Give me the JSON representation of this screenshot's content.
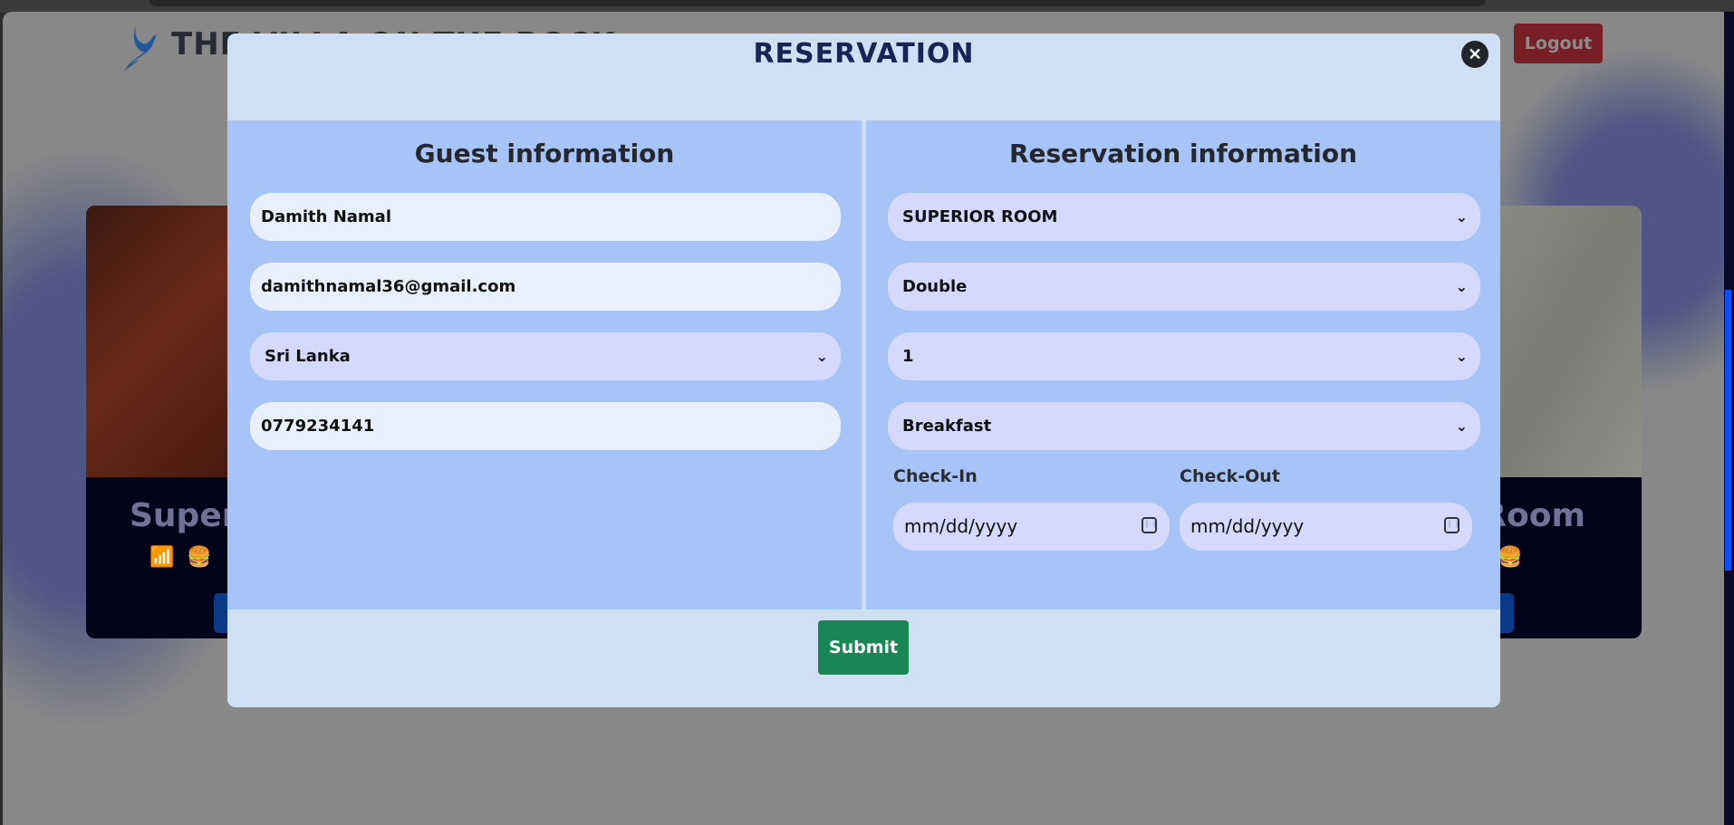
{
  "background": {
    "brand": "THE VILLA ON THE ROCK",
    "logout_label": "Logout",
    "cards": [
      {
        "title": "Superior Room",
        "amenities": [
          "wifi-icon",
          "burger-icon"
        ]
      },
      {
        "title": "Room",
        "amenities": [
          "burger-icon"
        ]
      }
    ]
  },
  "modal": {
    "title": "RESERVATION",
    "close_icon": "close-icon",
    "guest": {
      "heading": "Guest information",
      "name": "Damith Namal",
      "email": "damithnamal36@gmail.com",
      "country": "Sri Lanka",
      "phone": "0779234141"
    },
    "reservation": {
      "heading": "Reservation information",
      "room_type": "SUPERIOR ROOM",
      "bed_type": "Double",
      "rooms": "1",
      "meal_plan": "Breakfast",
      "check_in_label": "Check-In",
      "check_out_label": "Check-Out",
      "check_in_placeholder": "mm/dd/yyyy",
      "check_out_placeholder": "mm/dd/yyyy"
    },
    "submit_label": "Submit"
  },
  "colors": {
    "submit": "#198754",
    "logout": "#771f25",
    "modal_bg": "#cfe0f5",
    "panel_bg": "#a7c4f9"
  }
}
